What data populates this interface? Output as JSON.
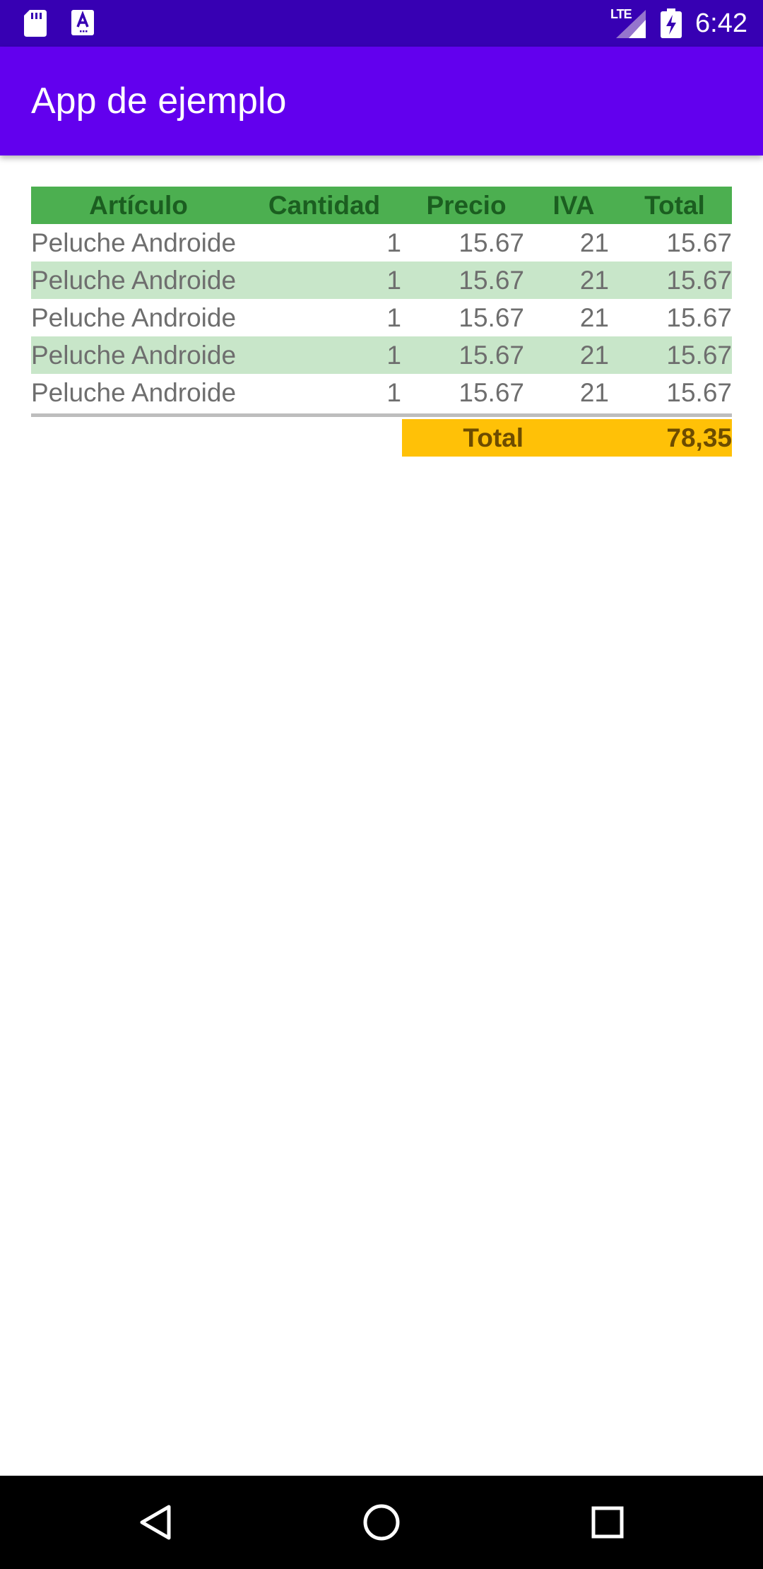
{
  "status_bar": {
    "time": "6:42",
    "network": "LTE",
    "icons": [
      "sd-card-icon",
      "adb-icon",
      "signal-icon",
      "battery-charging-icon"
    ]
  },
  "app_bar": {
    "title": "App de ejemplo",
    "color": "#6200ee"
  },
  "table": {
    "headers": {
      "articulo": "Artículo",
      "cantidad": "Cantidad",
      "precio": "Precio",
      "iva": "IVA",
      "total": "Total"
    },
    "rows": [
      {
        "articulo": "Peluche Androide",
        "cantidad": "1",
        "precio": "15.67",
        "iva": "21",
        "total": "15.67"
      },
      {
        "articulo": "Peluche Androide",
        "cantidad": "1",
        "precio": "15.67",
        "iva": "21",
        "total": "15.67"
      },
      {
        "articulo": "Peluche Androide",
        "cantidad": "1",
        "precio": "15.67",
        "iva": "21",
        "total": "15.67"
      },
      {
        "articulo": "Peluche Androide",
        "cantidad": "1",
        "precio": "15.67",
        "iva": "21",
        "total": "15.67"
      },
      {
        "articulo": "Peluche Androide",
        "cantidad": "1",
        "precio": "15.67",
        "iva": "21",
        "total": "15.67"
      }
    ],
    "summary": {
      "label": "Total",
      "value": "78,35"
    },
    "colors": {
      "header_bg": "#4caf50",
      "header_text": "#1b5e20",
      "alt_row_bg": "#c8e6c9",
      "total_bg": "#ffc107"
    }
  },
  "nav_bar": {
    "buttons": [
      "back-icon",
      "home-icon",
      "recent-apps-icon"
    ]
  }
}
